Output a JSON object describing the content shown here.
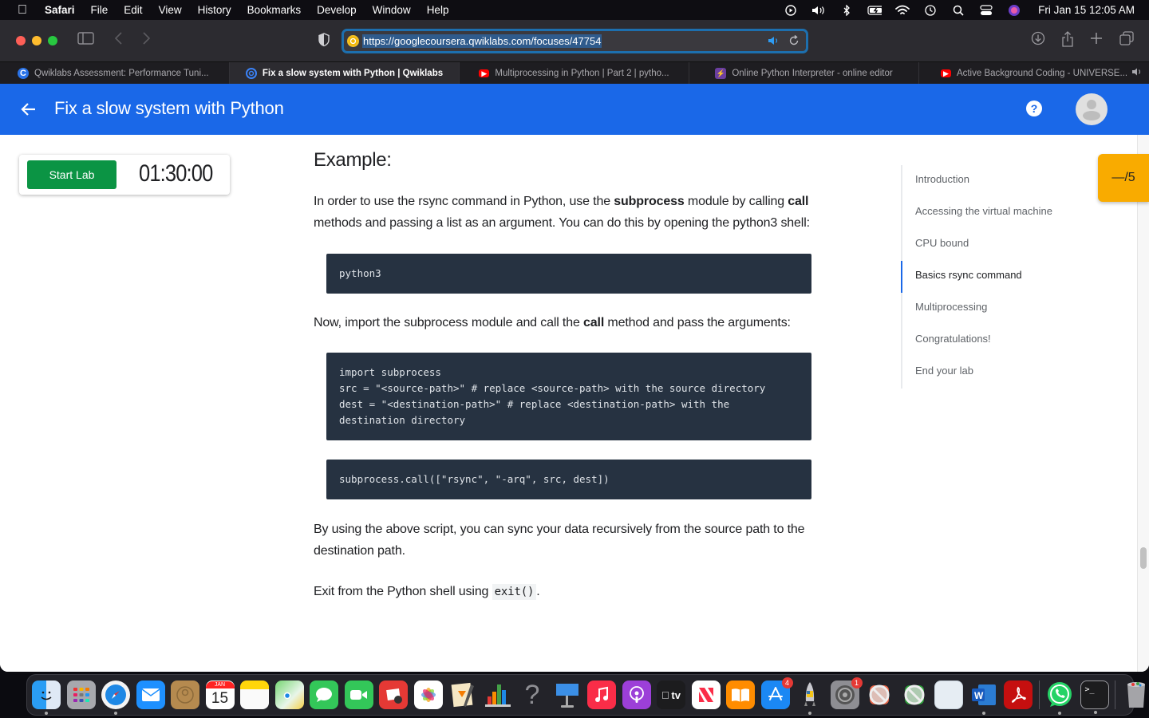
{
  "menubar": {
    "app": "Safari",
    "items": [
      "File",
      "Edit",
      "View",
      "History",
      "Bookmarks",
      "Develop",
      "Window",
      "Help"
    ],
    "status_icons": [
      "play-circle-icon",
      "volume-icon",
      "bluetooth-icon",
      "battery-charging-icon",
      "wifi-icon",
      "time-machine-icon",
      "spotlight-search-icon",
      "control-center-icon",
      "siri-icon"
    ],
    "datetime": "Fri Jan 15  12:05 AM"
  },
  "browser": {
    "url": "https://googlecoursera.qwiklabs.com/focuses/47754",
    "tabs": [
      {
        "label": "Qwiklabs Assessment: Performance Tuni...",
        "icon": "coursera-icon",
        "active": false
      },
      {
        "label": "Fix a slow system with Python | Qwiklabs",
        "icon": "qwiklabs-icon",
        "active": true
      },
      {
        "label": "Multiprocessing in Python | Part 2 | pytho...",
        "icon": "youtube-icon",
        "active": false
      },
      {
        "label": "Online Python Interpreter - online editor",
        "icon": "bolt-icon",
        "active": false
      },
      {
        "label": "Active Background Coding - UNIVERSE...",
        "icon": "youtube-icon",
        "active": false,
        "audio": true
      }
    ]
  },
  "page": {
    "title": "Fix a slow system with Python",
    "lab": {
      "start_label": "Start Lab",
      "timer": "01:30:00"
    },
    "score": "—/5",
    "content": {
      "heading": "Example:",
      "p1": {
        "t1": "In order to use the rsync command in Python, use the ",
        "b1": "subprocess",
        "t2": " module by calling ",
        "b2": "call",
        "t3": " methods and passing a list as an argument. You can do this by opening the python3 shell:"
      },
      "code1": "python3",
      "p2": {
        "t1": "Now, import the subprocess module and call the ",
        "b1": "call",
        "t2": " method and pass the arguments:"
      },
      "code2": "import subprocess\nsrc = \"<source-path>\" # replace <source-path> with the source directory\ndest = \"<destination-path>\" # replace <destination-path> with the\ndestination directory",
      "code3": "subprocess.call([\"rsync\", \"-arq\", src, dest])",
      "p3": "By using the above script, you can sync your data recursively from the source path to the destination path.",
      "p4": {
        "t1": "Exit from the Python shell using ",
        "code": "exit()",
        "t2": "."
      }
    },
    "toc": [
      {
        "label": "Introduction",
        "active": false
      },
      {
        "label": "Accessing the virtual machine",
        "active": false
      },
      {
        "label": "CPU bound",
        "active": false
      },
      {
        "label": "Basics rsync command",
        "active": true
      },
      {
        "label": "Multiprocessing",
        "active": false
      },
      {
        "label": "Congratulations!",
        "active": false
      },
      {
        "label": "End your lab",
        "active": false
      }
    ]
  },
  "dock": {
    "calendar_month": "JAN",
    "calendar_day": "15",
    "appstore_badge": "4",
    "settings_badge": "1",
    "tv_label": " tv",
    "word_label": "W"
  }
}
